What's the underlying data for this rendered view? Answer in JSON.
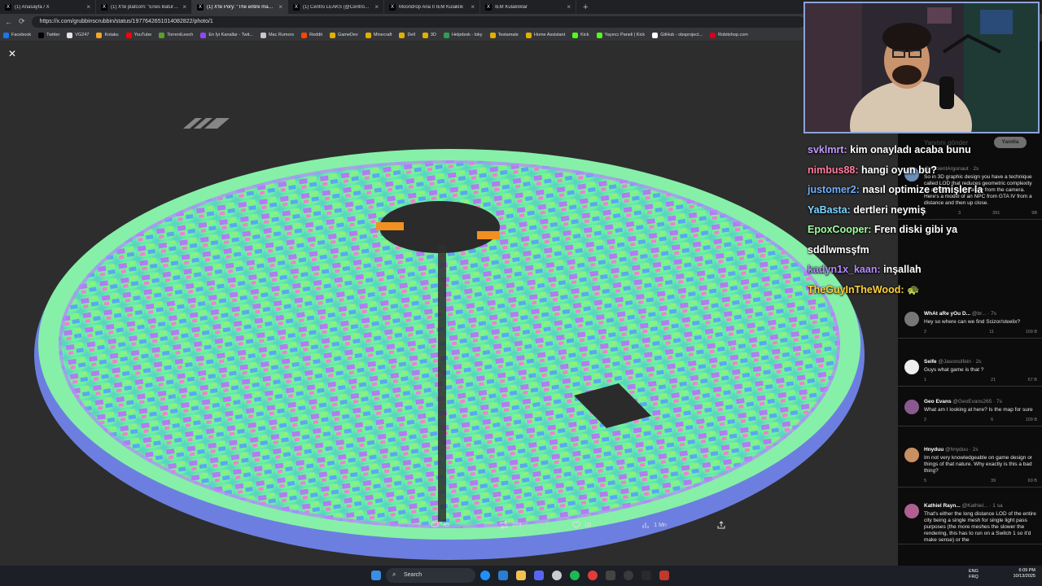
{
  "tabs": [
    {
      "label": "(1) Anasayfa / X",
      "active": false
    },
    {
      "label": "(1) X'te platcom: \"Enes Batur: wh",
      "active": false
    },
    {
      "label": "(1) X'te Pory: \"The entire map is D",
      "active": true
    },
    {
      "label": "(1) Centro LEAKS (@CentroLeaks)",
      "active": false
    },
    {
      "label": "Moondrop Aria II IEM Kulaklık",
      "active": false
    },
    {
      "label": "IEM Kulaklıklar",
      "active": false
    }
  ],
  "address": {
    "url": "https://x.com/grubbinscrubbin/status/1977642651014082822/photo/1"
  },
  "bookmarks": [
    {
      "label": "Facebook",
      "color": "#1877f2"
    },
    {
      "label": "Twitter",
      "color": "#000000"
    },
    {
      "label": "VG247",
      "color": "#e4e4e4"
    },
    {
      "label": "Kotaku",
      "color": "#f5a623"
    },
    {
      "label": "YouTube",
      "color": "#ff0000"
    },
    {
      "label": "TorrentLeech",
      "color": "#5aa02c"
    },
    {
      "label": "En İyi Kanallar - Twit...",
      "color": "#9146ff"
    },
    {
      "label": "Mac Rumors",
      "color": "#c9c9c9"
    },
    {
      "label": "Reddit",
      "color": "#ff4500"
    },
    {
      "label": "GameDev",
      "color": "#e0b000"
    },
    {
      "label": "Minecraft",
      "color": "#e0b000"
    },
    {
      "label": "Dell",
      "color": "#e0b000"
    },
    {
      "label": "3D",
      "color": "#e0b000"
    },
    {
      "label": "Helpdesk - loky",
      "color": "#2e9e4f"
    },
    {
      "label": "Testamate",
      "color": "#e0b000"
    },
    {
      "label": "Home Assistant",
      "color": "#e0b000"
    },
    {
      "label": "Kick",
      "color": "#53fc18"
    },
    {
      "label": "Yayıncı Paneli | Kick",
      "color": "#53fc18"
    },
    {
      "label": "GitHub - obsproject...",
      "color": "#ffffff"
    },
    {
      "label": "Robitshop.com",
      "color": "#d6001c"
    }
  ],
  "engagement": {
    "replies": "45",
    "reposts": "273",
    "likes": "1B",
    "views": "1 Mn"
  },
  "chat": [
    {
      "user": "svklmrt:",
      "color": "#c39bff",
      "msg": "kim onayladı acaba bunu"
    },
    {
      "user": "nimbus88:",
      "color": "#ff7ea0",
      "msg": "hangi oyun bu?"
    },
    {
      "user": "justomer2:",
      "color": "#6fb0ff",
      "msg": "nasıl optimize etmişler la"
    },
    {
      "user": "YaBasta:",
      "color": "#7fd4ff",
      "msg": "dertleri neymiş"
    },
    {
      "user": "EpoxCooper:",
      "color": "#9dffa0",
      "msg": "Fren diski gibi ya"
    },
    {
      "user": "",
      "color": "#ffffff",
      "msg": "sddlwmsşfm"
    },
    {
      "user": "kadyn1x_kaan:",
      "color": "#b58cff",
      "msg": "inşallah"
    },
    {
      "user": "TheGuyInTheWood:",
      "color": "#ffd23f",
      "msg": "🐢"
    }
  ],
  "reply_box": {
    "placeholder": "Yanıtını gönder",
    "button": "Yanıtla"
  },
  "tweets": [
    {
      "name": "",
      "handle": "@AncientArgonaut · 2s",
      "text": "So in 3D graphic design you have a technique called LOD that reduces geometric complexity as an object moves away from the camera. Here's a model of an NPC from GTA IV from a distance and then up close.",
      "stats": [
        "3",
        "3",
        "391",
        "9B"
      ],
      "avatar": "#6a8fb5"
    },
    {
      "name": "WhAt aRe yOu D...",
      "handle": "@br... · 7s",
      "text": "Hey so where can we find Scizor/steelix?",
      "stats": [
        "2",
        "",
        "11",
        "109 B"
      ],
      "avatar": "#777777"
    },
    {
      "name": "Seife",
      "handle": "@Jasonsilfein · 2s",
      "text": "Guys what game is that ?",
      "stats": [
        "1",
        "",
        "21",
        "67 B"
      ],
      "avatar": "#eeeeee"
    },
    {
      "name": "Geo Evans",
      "handle": "@GeoEvans265 · 7s",
      "text": "What am I looking at here? Is the map for sure",
      "stats": [
        "2",
        "",
        "6",
        "109 B"
      ],
      "avatar": "#8a5a8f"
    },
    {
      "name": "Hnyduu",
      "handle": "@hnyduu · 2s",
      "text": "Im not very knowledgeable on game design or things of that nature. Why exactly is this a bad thing?",
      "stats": [
        "5",
        "",
        "39",
        "69 B"
      ],
      "avatar": "#c89060"
    },
    {
      "name": "Kathiel Rayn...",
      "handle": "@Kathiel... · 1 sa",
      "text": "That's either the long distance LOD of the entire city being a single mesh for single light pass purposes (the more meshes the slower the rendering, this has to run on a Switch 1 so it'd make sense) or the",
      "stats": [],
      "avatar": "#b06090"
    }
  ],
  "taskbar": {
    "search": "Search",
    "lang": "ENG",
    "lang2": "FRQ",
    "time": "6:09 PM",
    "date": "10/13/2025"
  }
}
